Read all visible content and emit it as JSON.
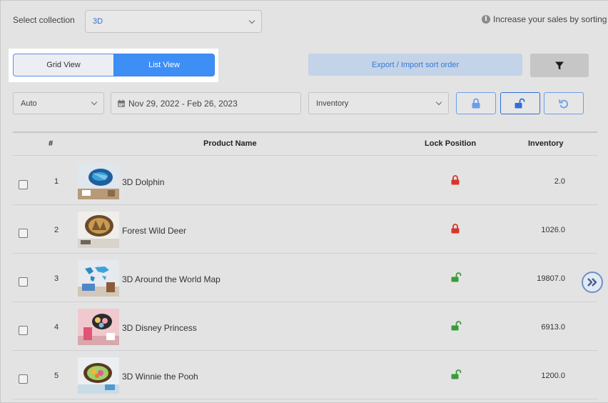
{
  "header": {
    "collection_label": "Select collection",
    "collection_value": "3D",
    "info_text": "Increase your sales by sorting"
  },
  "view_toggle": {
    "grid_label": "Grid View",
    "list_label": "List View",
    "active": "List View"
  },
  "toolbar": {
    "export_label": "Export / Import sort order",
    "sort_mode": "Auto",
    "date_range": "Nov 29, 2022 - Feb 26, 2023",
    "sort_field": "Inventory"
  },
  "table": {
    "columns": [
      "#",
      "Product Name",
      "Lock Position",
      "Inventory"
    ],
    "rows": [
      {
        "num": "1",
        "name": "3D Dolphin",
        "locked": true,
        "inventory": "2.0"
      },
      {
        "num": "2",
        "name": "Forest Wild Deer",
        "locked": true,
        "inventory": "1026.0"
      },
      {
        "num": "3",
        "name": "3D Around the World Map",
        "locked": false,
        "inventory": "19807.0"
      },
      {
        "num": "4",
        "name": "3D Disney Princess",
        "locked": false,
        "inventory": "6913.0"
      },
      {
        "num": "5",
        "name": "3D Winnie the Pooh",
        "locked": false,
        "inventory": "1200.0"
      }
    ]
  },
  "colors": {
    "accent": "#3d8ef5",
    "lock_red": "#d9342b",
    "unlock_green": "#3a9b3a"
  }
}
